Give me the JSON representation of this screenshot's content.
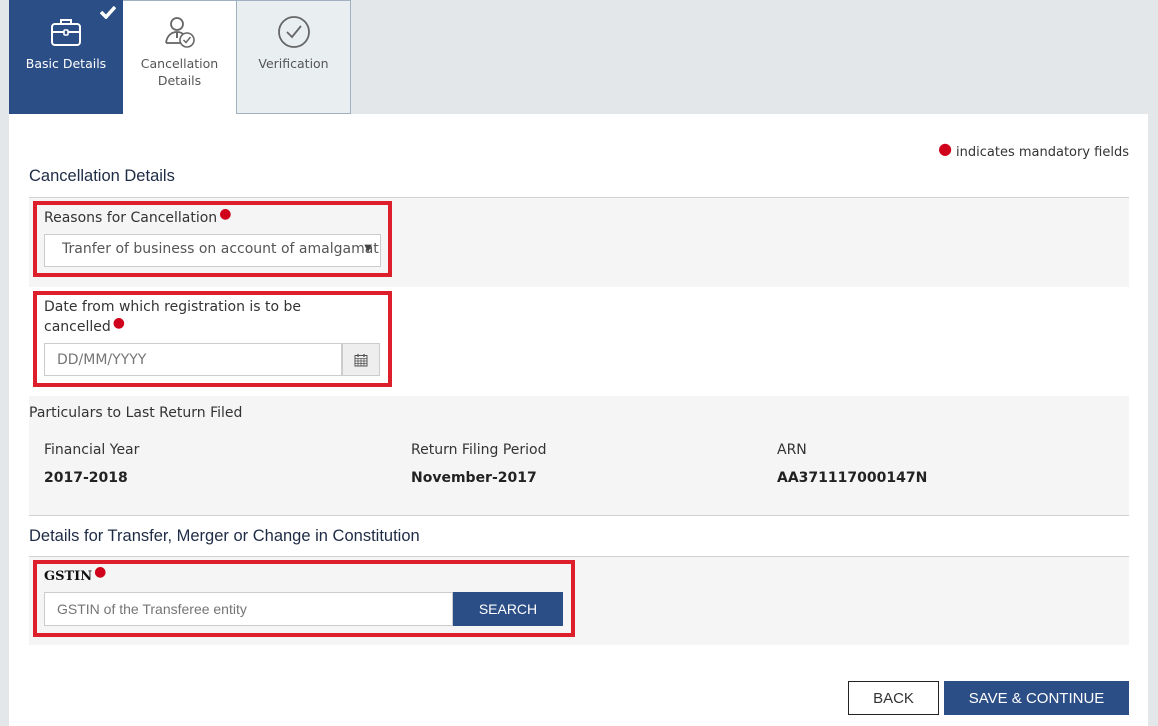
{
  "tabs": [
    {
      "label": "Basic Details",
      "state": "completed",
      "icon": "briefcase-icon"
    },
    {
      "label": "Cancellation Details",
      "state": "current",
      "icon": "user-check-icon"
    },
    {
      "label": "Verification",
      "state": "pending",
      "icon": "check-circle-icon"
    }
  ],
  "mandatory_note": "indicates mandatory fields",
  "sections": {
    "cancellation": {
      "title": "Cancellation Details",
      "reason": {
        "label": "Reasons for Cancellation",
        "selected": "Tranfer of business on account of amalgamation"
      },
      "date": {
        "label": "Date from which registration is to be cancelled",
        "placeholder": "DD/MM/YYYY"
      }
    },
    "last_return": {
      "title": "Particulars to Last Return Filed",
      "columns": [
        {
          "label": "Financial Year",
          "value": "2017-2018"
        },
        {
          "label": "Return Filing Period",
          "value": "November-2017"
        },
        {
          "label": "ARN",
          "value": "AA371117000147N"
        }
      ]
    },
    "transfer": {
      "title": "Details for Transfer, Merger or Change in Constitution",
      "gstin": {
        "label": "GSTIN",
        "placeholder": "GSTIN of the Transferee entity",
        "search_label": "SEARCH"
      }
    }
  },
  "actions": {
    "back_label": "BACK",
    "save_label": "SAVE & CONTINUE"
  },
  "colors": {
    "primary": "#2c4e86",
    "mandatory": "#d0021b",
    "highlight": "#dc1f2a"
  }
}
